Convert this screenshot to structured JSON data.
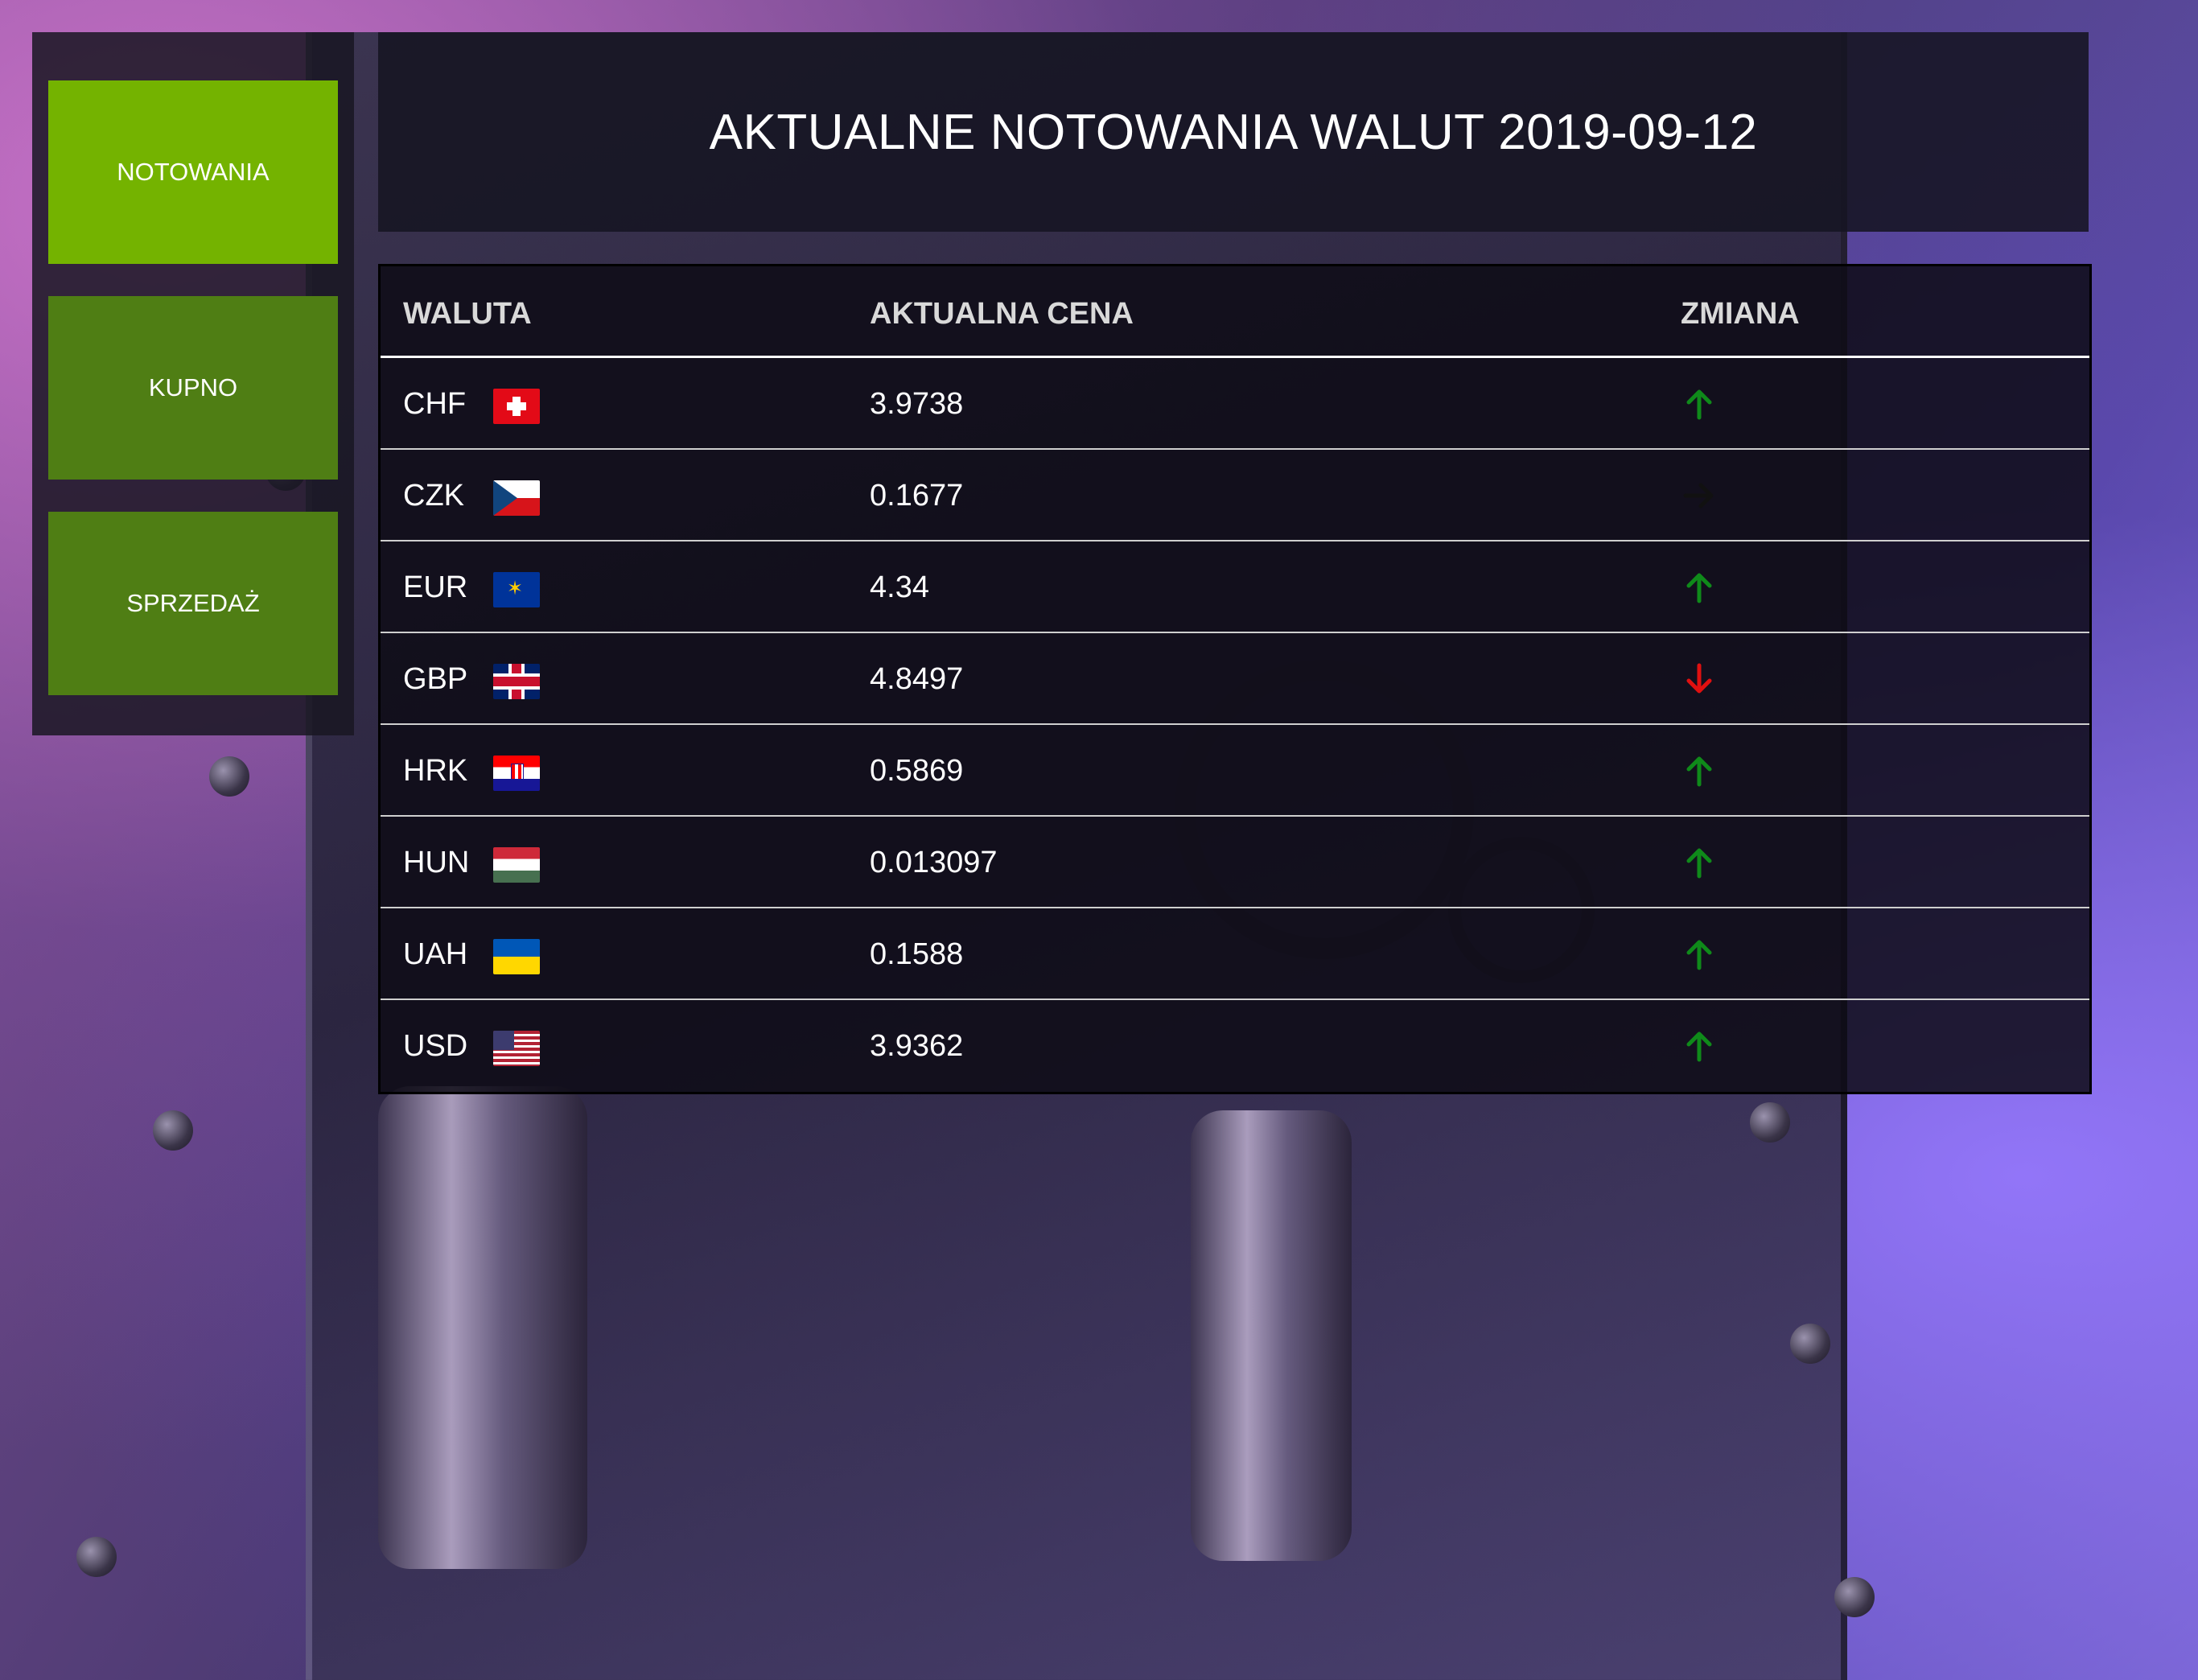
{
  "nav": {
    "items": [
      {
        "label": "NOTOWANIA",
        "active": true
      },
      {
        "label": "KUPNO",
        "active": false
      },
      {
        "label": "SPRZEDAŻ",
        "active": false
      }
    ]
  },
  "header": {
    "title": "AKTUALNE NOTOWANIA WALUT 2019-09-12"
  },
  "table": {
    "columns": [
      "WALUTA",
      "AKTUALNA CENA",
      "ZMIANA"
    ],
    "rows": [
      {
        "code": "CHF",
        "flag": "swiss-flag-icon",
        "price": "3.9738",
        "change": "up"
      },
      {
        "code": "CZK",
        "flag": "czech-flag-icon",
        "price": "0.1677",
        "change": "flat"
      },
      {
        "code": "EUR",
        "flag": "eu-flag-icon",
        "price": "4.34",
        "change": "up"
      },
      {
        "code": "GBP",
        "flag": "uk-flag-icon",
        "price": "4.8497",
        "change": "down"
      },
      {
        "code": "HRK",
        "flag": "croatia-flag-icon",
        "price": "0.5869",
        "change": "up"
      },
      {
        "code": "HUN",
        "flag": "hungary-flag-icon",
        "price": "0.013097",
        "change": "up"
      },
      {
        "code": "UAH",
        "flag": "ukraine-flag-icon",
        "price": "0.1588",
        "change": "up"
      },
      {
        "code": "USD",
        "flag": "usa-flag-icon",
        "price": "3.9362",
        "change": "up"
      }
    ]
  },
  "colors": {
    "nav_active": "#74b300",
    "nav_inactive": "#4f7e14",
    "arrow_up": "#0f8a1a",
    "arrow_down": "#e01010",
    "arrow_flat": "#111111"
  }
}
